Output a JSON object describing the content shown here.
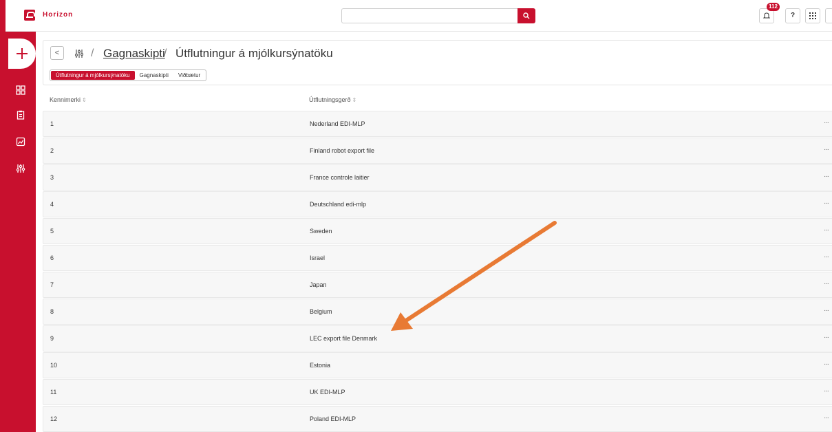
{
  "app": {
    "brand": "Horizon",
    "accent": "#c8102e"
  },
  "search": {
    "placeholder": ""
  },
  "topbar": {
    "notification_count": "112",
    "help_label": "?",
    "icons": [
      "bell-icon",
      "help-icon",
      "apps-grid-icon"
    ]
  },
  "sidebar": {
    "items": [
      {
        "icon": "add-icon"
      },
      {
        "icon": "dashboard-icon"
      },
      {
        "icon": "clipboard-icon"
      },
      {
        "icon": "chart-report-icon"
      },
      {
        "icon": "sliders-icon"
      }
    ]
  },
  "header": {
    "back_label": "<",
    "breadcrumb_link": "Gagnaskipti",
    "breadcrumb_current": "Útflutningur á mjólkursýnatöku",
    "separator": "/",
    "tabs": [
      {
        "label": "Útflutningur á mjólkursýnatöku",
        "active": true
      },
      {
        "label": "Gagnaskipti",
        "active": false
      },
      {
        "label": "Viðbætur",
        "active": false
      }
    ]
  },
  "table": {
    "columns": [
      "Kennimerki",
      "Útflutningsgerð"
    ],
    "sort_indicator": "⇕",
    "row_menu": "···",
    "rows": [
      {
        "id": "1",
        "type": "Nederland EDI-MLP"
      },
      {
        "id": "2",
        "type": "Finland robot export file"
      },
      {
        "id": "3",
        "type": "France controle laitier"
      },
      {
        "id": "4",
        "type": "Deutschland edi-mlp"
      },
      {
        "id": "5",
        "type": "Sweden"
      },
      {
        "id": "6",
        "type": "Israel"
      },
      {
        "id": "7",
        "type": "Japan"
      },
      {
        "id": "8",
        "type": "Belgium"
      },
      {
        "id": "9",
        "type": "LEC export file Denmark"
      },
      {
        "id": "10",
        "type": "Estonia"
      },
      {
        "id": "11",
        "type": "UK EDI-MLP"
      },
      {
        "id": "12",
        "type": "Poland EDI-MLP"
      }
    ]
  },
  "annotation": {
    "arrow_color": "#e87a34",
    "points_to_row": "9"
  }
}
